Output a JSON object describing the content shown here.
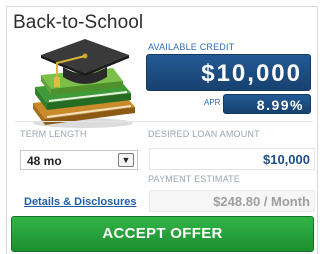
{
  "offer": {
    "title": "Back-to-School",
    "available_credit_label": "AVAILABLE CREDIT",
    "available_credit_value": "$10,000",
    "apr_label": "APR",
    "apr_value": "8.99%"
  },
  "form": {
    "term_label": "TERM LENGTH",
    "term_value": "48 mo",
    "amount_label": "DESIRED LOAN AMOUNT",
    "amount_value": "$10,000",
    "payment_label": "PAYMENT ESTIMATE",
    "payment_value": "$248.80 / Month",
    "details_link": "Details & Disclosures",
    "accept_label": "ACCEPT OFFER"
  },
  "icons": {
    "graphic": "graduation-cap-on-books-icon",
    "select_arrow": "chevron-down-icon"
  },
  "colors": {
    "accent_blue": "#1f4f86",
    "accept_green": "#26a03a",
    "label_gray": "#9aa5b1"
  }
}
